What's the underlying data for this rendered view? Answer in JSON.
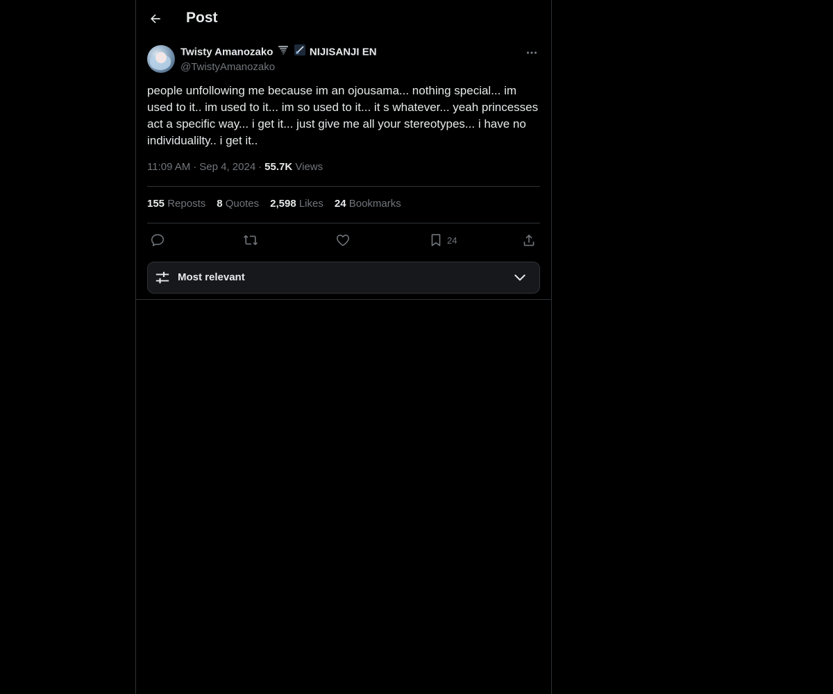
{
  "header": {
    "title": "Post"
  },
  "post": {
    "author": {
      "name": "Twisty Amanozako",
      "suffix": "NIJISANJI EN",
      "handle": "@TwistyAmanozako"
    },
    "text": "people unfollowing me because im an ojousama... nothing special... im used to it.. im used to it... im so used to it... it s whatever... yeah princesses act a specific way... i get it... just give me all your stereotypes... i have no individualilty.. i get it..",
    "time": "11:09 AM",
    "date": "Sep 4, 2024",
    "separator": "·",
    "views_count": "55.7K",
    "views_label": "Views"
  },
  "stats": {
    "reposts_count": "155",
    "reposts_label": "Reposts",
    "quotes_count": "8",
    "quotes_label": "Quotes",
    "likes_count": "2,598",
    "likes_label": "Likes",
    "bookmarks_count": "24",
    "bookmarks_label": "Bookmarks"
  },
  "actions": {
    "bookmark_count": "24",
    "icons": [
      "reply-icon",
      "repost-icon",
      "like-icon",
      "bookmark-icon",
      "share-icon"
    ]
  },
  "sort": {
    "label": "Most relevant"
  },
  "colors": {
    "background": "#000000",
    "text_primary": "#e7e9ea",
    "text_secondary": "#71767b",
    "border": "#2f3336",
    "sort_bar_bg": "#16181c"
  }
}
